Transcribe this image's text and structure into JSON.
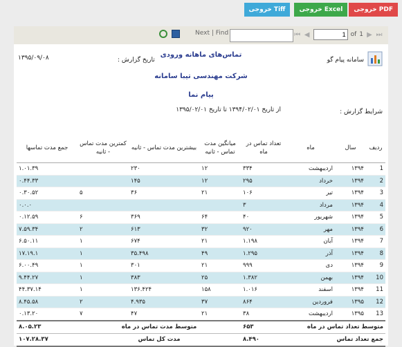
{
  "exports": {
    "tiff": "خروجی Tiff",
    "excel": "خروجی Excel",
    "pdf": "خروجی PDF"
  },
  "toolbar": {
    "next_label": "Next",
    "find_label": "Find",
    "of_label": "of",
    "total_pages": "1",
    "current_page": "1",
    "find_value": ""
  },
  "report": {
    "app_name": "سامانه پیام گو",
    "title": "تماس‌های ماهانه ورودی",
    "date_label": "تاریخ گزارش :",
    "date": "۱۳۹۵/۰۹/۰۸",
    "company": "شرکت مهندسی تیبا سامانه",
    "product": "پیام نما",
    "conditions_label": "شرایط گزارش :",
    "conditions": "از تاریخ ۱۳۹۴/۰۲/۰۱ تا تاریخ ۱۳۹۵/۰۲/۰۱"
  },
  "table": {
    "headers": {
      "row": "ردیف",
      "year": "سال",
      "month": "ماه",
      "count": "تعداد تماس در ماه",
      "avg": "میانگین مدت تماس - ثانیه",
      "max": "بیشترین مدت تماس - ثانیه",
      "min": "کمترین مدت تماس - ثانیه",
      "total": "جمع مدت تماسها"
    },
    "rows": [
      {
        "row": "1",
        "year": "۱۳۹۴",
        "month": "اردیبهشت",
        "count": "۳۳۴",
        "avg": "۱۲",
        "max": "۲۳۰",
        "min": "",
        "total": "۱.۰۱.۳۹"
      },
      {
        "row": "2",
        "year": "۱۳۹۴",
        "month": "خرداد",
        "count": "۲۹۵",
        "avg": "۱۲",
        "max": "۱۴۵",
        "min": "",
        "total": "۰.۴۴.۳۳"
      },
      {
        "row": "3",
        "year": "۱۳۹۴",
        "month": "تیر",
        "count": "۱۰۶",
        "avg": "۲۱",
        "max": "۳۶",
        "min": "۵",
        "total": "۰.۳۰.۵۲"
      },
      {
        "row": "4",
        "year": "۱۳۹۴",
        "month": "مرداد",
        "count": "۳",
        "avg": "",
        "max": "",
        "min": "",
        "total": "۰.۰.۰"
      },
      {
        "row": "5",
        "year": "۱۳۹۴",
        "month": "شهریور",
        "count": "۴۰",
        "avg": "۶۴",
        "max": "۳۶۹",
        "min": "۶",
        "total": "۰.۱۲.۵۹"
      },
      {
        "row": "6",
        "year": "۱۳۹۴",
        "month": "مهر",
        "count": "۹۲۰",
        "avg": "۳۲",
        "max": "۶۱۳",
        "min": "۲",
        "total": "۷.۵۹.۳۴"
      },
      {
        "row": "7",
        "year": "۱۳۹۴",
        "month": "آبان",
        "count": "۱.۱۹۸",
        "avg": "۲۱",
        "max": "۶۷۴",
        "min": "۱",
        "total": "۶.۵۰.۱۱"
      },
      {
        "row": "8",
        "year": "۱۳۹۴",
        "month": "آذر",
        "count": "۱.۲۹۵",
        "avg": "۴۹",
        "max": "۳۵.۴۹۸",
        "min": "۱",
        "total": "۱۷.۱۹.۱"
      },
      {
        "row": "9",
        "year": "۱۳۹۴",
        "month": "دی",
        "count": "۹۹۹",
        "avg": "۲۱",
        "max": "۳۰۱",
        "min": "۱",
        "total": "۶.۰۰.۴۹"
      },
      {
        "row": "10",
        "year": "۱۳۹۴",
        "month": "بهمن",
        "count": "۱.۳۸۲",
        "avg": "۲۵",
        "max": "۳۸۳",
        "min": "۱",
        "total": "۹.۴۴.۲۷"
      },
      {
        "row": "11",
        "year": "۱۳۹۴",
        "month": "اسفند",
        "count": "۱.۰۱۶",
        "avg": "۱۵۸",
        "max": "۱۳۶.۴۲۴",
        "min": "۱",
        "total": "۴۴.۳۷.۱۴"
      },
      {
        "row": "12",
        "year": "۱۳۹۵",
        "month": "فروردین",
        "count": "۸۶۴",
        "avg": "۳۷",
        "max": "۴.۹۳۵",
        "min": "۲",
        "total": "۸.۴۵.۵۸"
      },
      {
        "row": "13",
        "year": "۱۳۹۵",
        "month": "اردیبهشت",
        "count": "۳۸",
        "avg": "۲۱",
        "max": "۴۷",
        "min": "۷",
        "total": "۰.۱۳.۲۰"
      }
    ],
    "summary": {
      "avg_label": "متوسط تعداد تماس در ماه",
      "avg_value": "۶۵۳",
      "avg_dur_label": "متوسط مدت تماس در ماه",
      "avg_dur_value": "۸.۰۵.۲۳",
      "total_label": "جمع تعداد تماس",
      "total_value": "۸.۴۹۰",
      "total_dur_label": "مدت کل تماس",
      "total_dur_value": "۱۰۷.۲۸.۳۷"
    }
  }
}
